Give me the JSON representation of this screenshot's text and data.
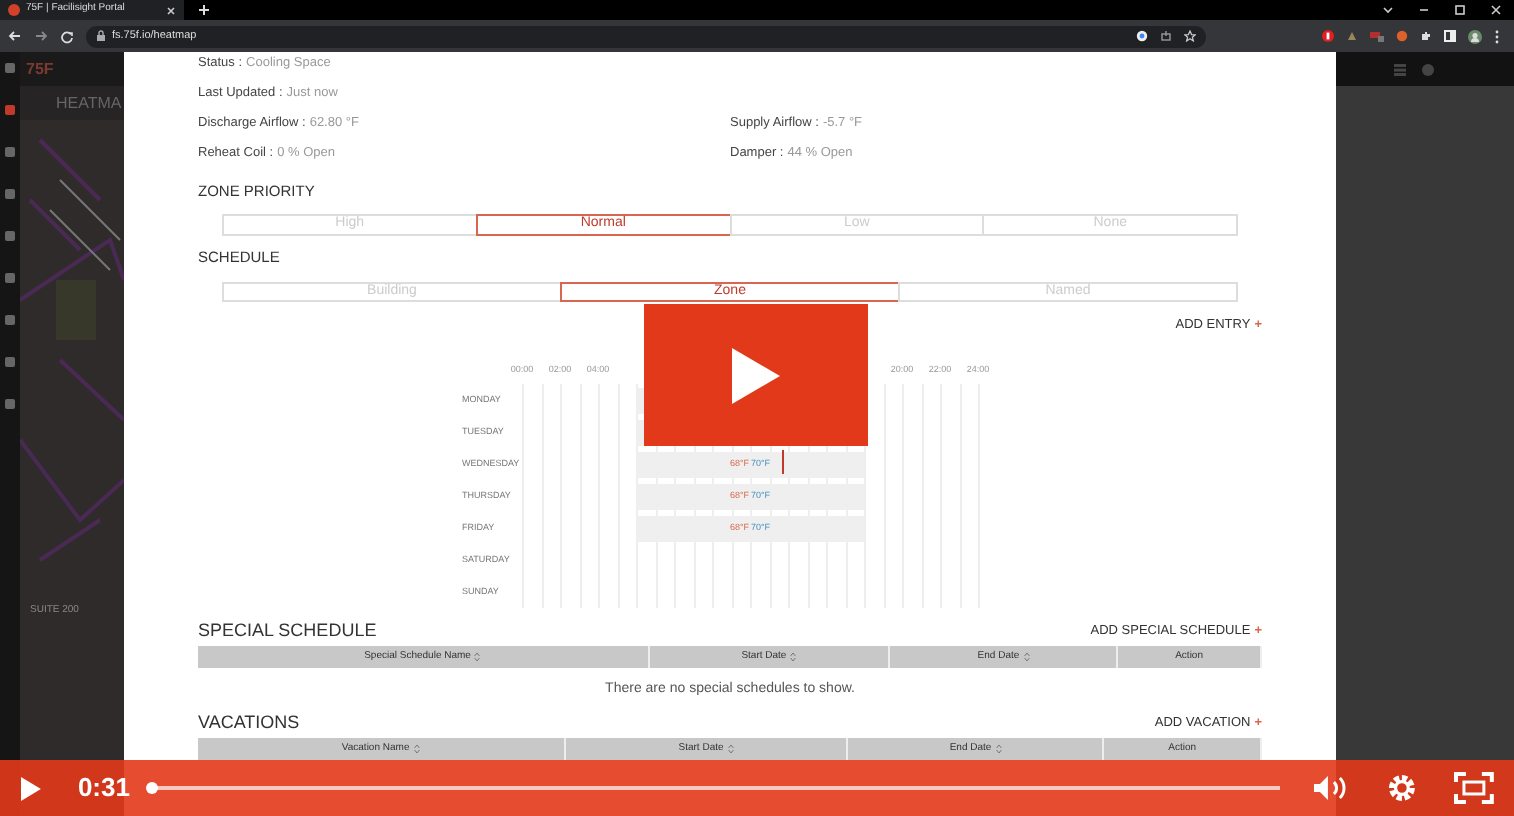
{
  "browser": {
    "tab_title": "75F | Facilisight Portal",
    "url": "fs.75f.io/heatmap"
  },
  "app": {
    "logo": "75F",
    "heading": "HEATMA",
    "map_label": "SUITE 200"
  },
  "zone_details": [
    [
      {
        "label": "Status :",
        "value": "Cooling Space"
      }
    ],
    [
      {
        "label": "Last Updated :",
        "value": "Just now"
      }
    ],
    [
      {
        "label": "Discharge Airflow :",
        "value": "62.80 °F"
      },
      {
        "label": "Supply Airflow :",
        "value": "-5.7 °F"
      }
    ],
    [
      {
        "label": "Reheat Coil :",
        "value": "0 % Open"
      },
      {
        "label": "Damper :",
        "value": "44 % Open"
      }
    ]
  ],
  "zone_priority": {
    "title": "ZONE PRIORITY",
    "options": [
      {
        "label": "High",
        "selected": false
      },
      {
        "label": "Normal",
        "selected": true
      },
      {
        "label": "Low",
        "selected": false
      },
      {
        "label": "None",
        "selected": false
      }
    ]
  },
  "schedule": {
    "title": "SCHEDULE",
    "options": [
      {
        "label": "Building",
        "selected": false
      },
      {
        "label": "Zone",
        "selected": true
      },
      {
        "label": "Named",
        "selected": false
      }
    ],
    "add_label": "ADD ENTRY",
    "add_icon": "+",
    "hours_left": [
      "00:00",
      "02:00",
      "04:00"
    ],
    "hours_right": [
      "20:00",
      "22:00",
      "24:00"
    ],
    "days": [
      {
        "label": "MONDAY",
        "bar": true
      },
      {
        "label": "TUESDAY",
        "bar": true
      },
      {
        "label": "WEDNESDAY",
        "bar": true,
        "heat": "68°F",
        "cool": "70°F"
      },
      {
        "label": "THURSDAY",
        "bar": true,
        "heat": "68°F",
        "cool": "70°F"
      },
      {
        "label": "FRIDAY",
        "bar": true,
        "heat": "68°F",
        "cool": "70°F"
      },
      {
        "label": "SATURDAY",
        "bar": false
      },
      {
        "label": "SUNDAY",
        "bar": false
      }
    ]
  },
  "special_schedule": {
    "title": "SPECIAL SCHEDULE",
    "add_label": "ADD SPECIAL SCHEDULE",
    "add_icon": "+",
    "columns": [
      "Special Schedule Name",
      "Start Date",
      "End Date",
      "Action"
    ],
    "empty_text": "There are no special schedules to show."
  },
  "vacations": {
    "title": "VACATIONS",
    "add_label": "ADD VACATION",
    "add_icon": "+",
    "columns": [
      "Vacation Name",
      "Start Date",
      "End Date",
      "Action"
    ]
  },
  "player": {
    "time": "0:31",
    "level": 0.0
  }
}
